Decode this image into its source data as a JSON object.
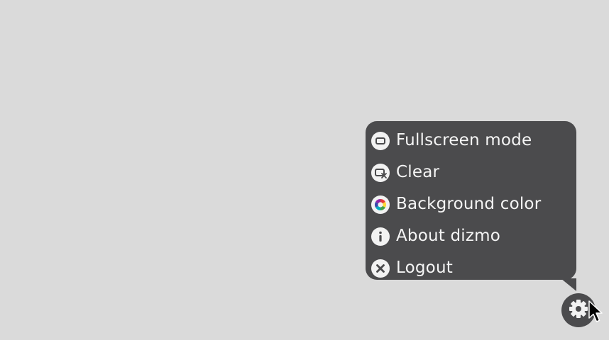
{
  "menu": {
    "items": [
      {
        "label": "Fullscreen mode",
        "icon": "fullscreen-icon"
      },
      {
        "label": "Clear",
        "icon": "clear-icon"
      },
      {
        "label": "Background color",
        "icon": "color-wheel-icon"
      },
      {
        "label": "About dizmo",
        "icon": "info-icon"
      },
      {
        "label": "Logout",
        "icon": "close-circle-icon"
      }
    ]
  },
  "settings_button": {
    "icon": "gear-icon"
  },
  "colors": {
    "background": "#dadada",
    "menu": "#4b4b4d",
    "menu_text": "#f5f5f5",
    "icon_fill": "#f2f2f2"
  }
}
